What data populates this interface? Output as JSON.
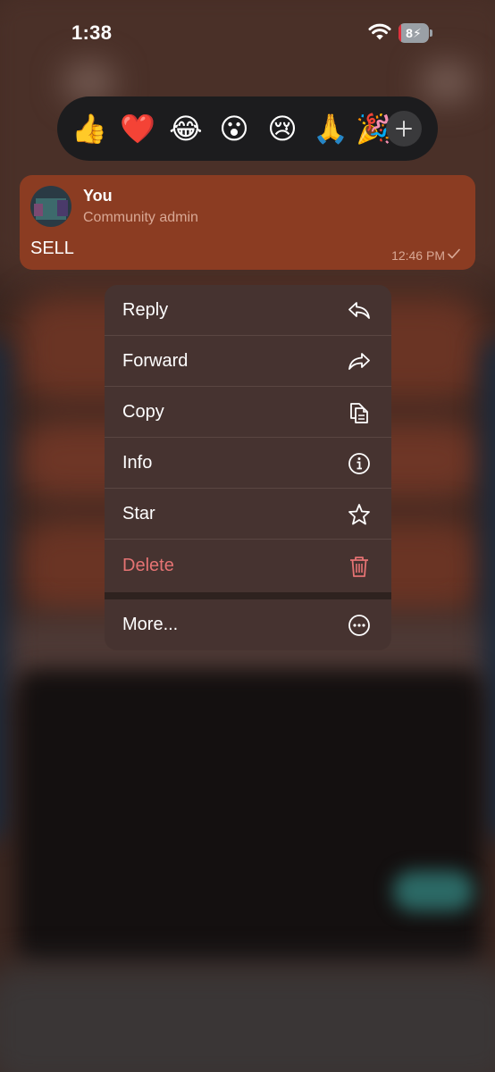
{
  "status_bar": {
    "time": "1:38",
    "battery_label": "8",
    "battery_level": 0.08
  },
  "reactions": {
    "emojis": [
      "👍",
      "❤️",
      "😂",
      "😮",
      "😢",
      "🙏",
      "🎉"
    ],
    "add_icon": "plus-icon"
  },
  "message": {
    "sender": "You",
    "role": "Community admin",
    "text": "SELL",
    "time": "12:46 PM",
    "status_icon": "checkmark-icon"
  },
  "menu": {
    "items": [
      {
        "label": "Reply",
        "icon": "reply-icon"
      },
      {
        "label": "Forward",
        "icon": "forward-icon"
      },
      {
        "label": "Copy",
        "icon": "copy-icon"
      },
      {
        "label": "Info",
        "icon": "info-icon"
      },
      {
        "label": "Star",
        "icon": "star-icon"
      },
      {
        "label": "Delete",
        "icon": "trash-icon",
        "color": "#e57373"
      },
      {
        "label": "More...",
        "icon": "more-icon"
      }
    ]
  },
  "colors": {
    "bubble": "#8b3c22",
    "menu_background": "#463330",
    "reaction_bar": "#1c1c1e",
    "destructive": "#e57373"
  }
}
